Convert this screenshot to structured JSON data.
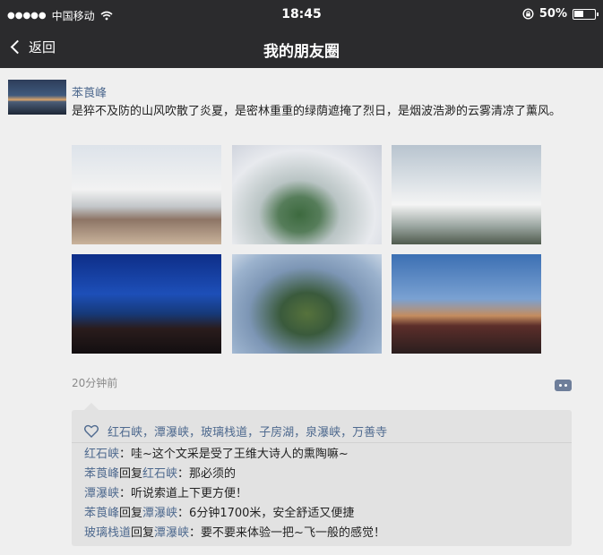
{
  "status_bar": {
    "signal": "●●●●●",
    "carrier": "中国移动",
    "time": "18:45",
    "battery": "50%",
    "icons": [
      "signal-dots-icon",
      "wifi-icon",
      "rotation-lock-icon",
      "battery-icon"
    ]
  },
  "nav": {
    "back_label": "返回",
    "title": "我的朋友圈"
  },
  "post": {
    "author": "苯莨峰",
    "text": "是猝不及防的山风吹散了炎夏，是密林重重的绿荫遮掩了烈日，是烟波浩渺的云雾清凉了薰风。",
    "time_ago": "20分钟前",
    "photo_count": 6
  },
  "likes": {
    "names": [
      "红石峡",
      "潭瀑峡",
      "玻璃栈道",
      "子房湖",
      "泉瀑峡",
      "万善寺"
    ],
    "separator": "，"
  },
  "comments": [
    {
      "from": "红石峡",
      "reply_word": "",
      "to": "",
      "text": "：哇~这个文采是受了王维大诗人的熏陶嘛~"
    },
    {
      "from": "苯莨峰",
      "reply_word": "回复",
      "to": "红石峡",
      "text": "：那必须的"
    },
    {
      "from": "潭瀑峡",
      "reply_word": "",
      "to": "",
      "text": "：听说索道上下更方便！"
    },
    {
      "from": "苯莨峰",
      "reply_word": "回复",
      "to": "潭瀑峡",
      "text": "：6分钟1700米，安全舒适又便捷"
    },
    {
      "from": "玻璃栈道",
      "reply_word": "回复",
      "to": "潭瀑峡",
      "text": "：要不要来体验一把~飞一般的感觉！"
    }
  ],
  "colors": {
    "bar": "#2b2b2d",
    "link": "#4f6a8f",
    "background": "#efefef",
    "comment_box": "#e2e2e2"
  }
}
